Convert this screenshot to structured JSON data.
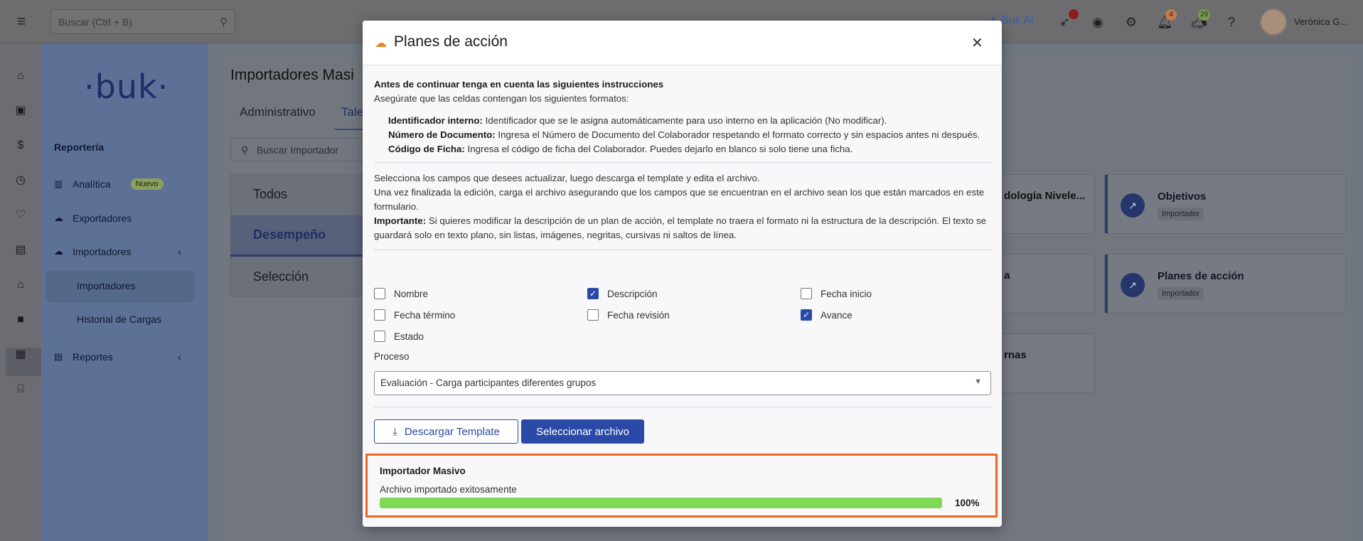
{
  "topbar": {
    "search_placeholder": "Buscar (Ctrl + B)",
    "buk_ai": "✦ Buk AI",
    "notif_badge": "4",
    "announce_badge": "29",
    "user_name": "Verónica G..."
  },
  "sidebar": {
    "logo": "·buk·",
    "section": "Reportería",
    "items": [
      {
        "label": "Analítica",
        "icon": "chart-icon",
        "badge": "Nuevo"
      },
      {
        "label": "Exportadores",
        "icon": "cloud-icon"
      },
      {
        "label": "Importadores",
        "icon": "cloud-upload-icon"
      },
      {
        "label": "Importadores"
      },
      {
        "label": "Historial de Cargas"
      },
      {
        "label": "Reportes",
        "icon": "report-icon"
      }
    ]
  },
  "background": {
    "title": "Importadores Masi",
    "tabs": [
      "Administrativo",
      "Tale"
    ],
    "search_placeholder": "Buscar Importador",
    "categories": [
      "Todos",
      "Desempeño",
      "Selección"
    ],
    "card_fragments": [
      "dología Nivele...",
      "a",
      "rnas"
    ],
    "cards": [
      {
        "title": "Objetivos",
        "tag": "Importador"
      },
      {
        "title": "Planes de acción",
        "tag": "Importador"
      }
    ]
  },
  "modal": {
    "title": "Planes de acción",
    "instructions_title": "Antes de continuar tenga en cuenta las siguientes instrucciones",
    "instructions_sub": "Asegúrate que las celdas contengan los siguientes formatos:",
    "fields": [
      {
        "name": "Identificador interno:",
        "desc": " Identificador que se le asigna automáticamente para uso interno en la aplicación (No modificar)."
      },
      {
        "name": "Número de Documento:",
        "desc": " Ingresa el Número de Documento del Colaborador respetando el formato correcto y sin espacios antes ni después."
      },
      {
        "name": "Código de Ficha:",
        "desc": " Ingresa el código de ficha del Colaborador. Puedes dejarlo en blanco si solo tiene una ficha."
      }
    ],
    "p1": "Selecciona los campos que desees actualizar, luego descarga el template y edita el archivo.",
    "p2": "Una vez finalizada la edición, carga el archivo asegurando que los campos que se encuentran en el archivo sean los que están marcados en este formulario.",
    "important_label": "Importante:",
    "important_text": " Si quieres modificar la descripción de un plan de acción, el template no traera el formato ni la estructura de la descripción. El texto se guardará solo en texto plano, sin listas, imágenes, negritas, cursivas ni saltos de línea.",
    "checkboxes": [
      {
        "label": "Nombre",
        "checked": false
      },
      {
        "label": "Descripción",
        "checked": true
      },
      {
        "label": "Fecha inicio",
        "checked": false
      },
      {
        "label": "Fecha término",
        "checked": false
      },
      {
        "label": "Fecha revisión",
        "checked": false
      },
      {
        "label": "Avance",
        "checked": true
      },
      {
        "label": "Estado",
        "checked": false
      }
    ],
    "process_label": "Proceso",
    "process_value": "Evaluación - Carga participantes diferentes grupos",
    "download_button": "Descargar Template",
    "select_button": "Seleccionar archivo",
    "import_title": "Importador Masivo",
    "import_status": "Archivo importado exitosamente",
    "progress": 1.0,
    "progress_label": "100%"
  },
  "colors": {
    "accent": "#2b4aa7",
    "progress": "#7ed957",
    "highlight": "#f0651f"
  }
}
